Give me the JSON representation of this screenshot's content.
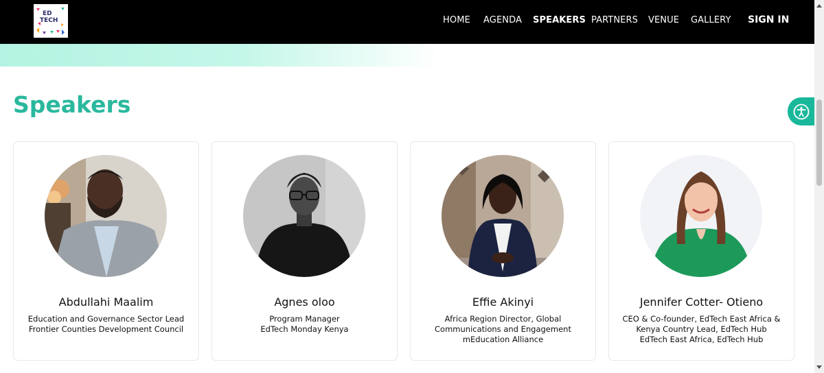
{
  "header": {
    "logo_text": [
      "ED",
      "TECH"
    ],
    "nav": [
      "HOME",
      "AGENDA",
      "SPEAKERS",
      "PARTNERS",
      "VENUE",
      "GALLERY"
    ],
    "active": "SPEAKERS",
    "signin_label": "SIGN IN"
  },
  "page": {
    "title": "Speakers"
  },
  "speakers": [
    {
      "name": "Abdullahi Maalim",
      "lines": [
        "Education and Governance Sector Lead",
        "Frontier Counties Development Council"
      ]
    },
    {
      "name": "Agnes oloo",
      "lines": [
        "Program Manager",
        "EdTech Monday Kenya"
      ]
    },
    {
      "name": "Effie Akinyi",
      "lines": [
        "Africa Region Director, Global",
        "Communications and Engagement",
        "mEducation Alliance"
      ]
    },
    {
      "name": "Jennifer Cotter- Otieno",
      "lines": [
        "CEO & Co-founder, EdTech East Africa &",
        "Kenya Country Lead, EdTech Hub",
        "EdTech East Africa, EdTech Hub"
      ]
    }
  ],
  "colors": {
    "accent": "#1ab89b",
    "title": "#2ab89d",
    "header_bg": "#000000"
  },
  "icons": {
    "accessibility": "accessibility-icon"
  }
}
